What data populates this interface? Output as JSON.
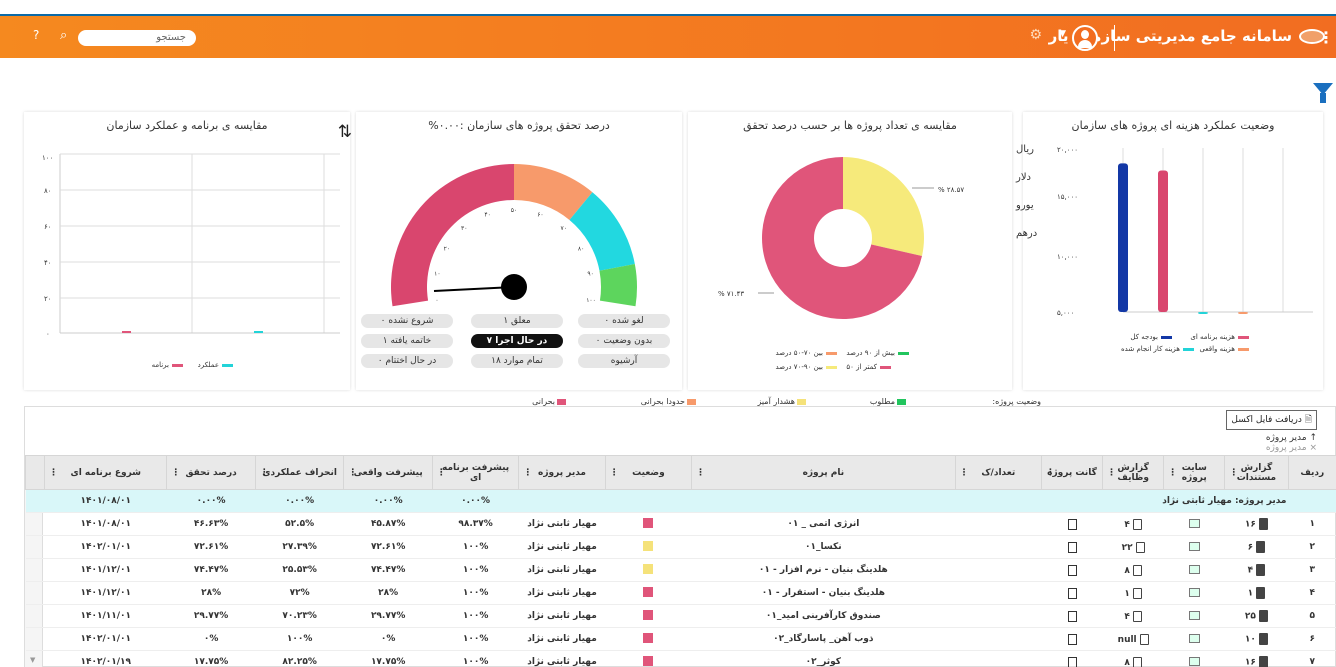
{
  "header": {
    "title": "سامانه جامع مدیریتی سازمان یار",
    "search_placeholder": "جستجو",
    "help_label": "?"
  },
  "cost_chart": {
    "title": "وضعیت عملکرد هزینه ای پروژه های سازمان",
    "currencies": [
      "ریال",
      "دلار",
      "یورو",
      "درهم"
    ],
    "legend": [
      "هزینه برنامه ای",
      "بودجه کل",
      "هزینه واقعی",
      "هزینه کار انجام شده"
    ],
    "yticks": [
      "۲۰,۰۰۰",
      "۱۵,۰۰۰",
      "۱۰,۰۰۰",
      "۵,۰۰۰"
    ]
  },
  "count_chart": {
    "title": "مقایسه ی تعداد پروژه ها بر حسب درصد تحقق",
    "label_big": "% ۷۱.۴۳",
    "label_small": "% ۲۸.۵۷",
    "legend": [
      "بیش از ۹۰ درصد",
      "بین ۷۰-۵۰ درصد",
      "کمتر از ۵۰",
      "بین ۹۰-۷۰ درصد"
    ]
  },
  "progress_chart": {
    "title": "درصد تحقق پروژه های سازمان :۰.۰۰%",
    "gauge_ticks": [
      "۰",
      "۱۰",
      "۲۰",
      "۳۰",
      "۴۰",
      "۵۰",
      "۶۰",
      "۷۰",
      "۸۰",
      "۹۰",
      "۱۰۰"
    ],
    "status_buttons": [
      {
        "label": "لغو شده ۰",
        "active": false
      },
      {
        "label": "معلق ۱",
        "active": false
      },
      {
        "label": "شروع نشده ۰",
        "active": false
      },
      {
        "label": "بدون وضعیت ۰",
        "active": false
      },
      {
        "label": "در حال اجرا ۷",
        "active": true
      },
      {
        "label": "خاتمه یافته ۱",
        "active": false
      },
      {
        "label": "آرشیوه",
        "active": false
      },
      {
        "label": "تمام موارد ۱۸",
        "active": false
      },
      {
        "label": "در حال اختتام ۰",
        "active": false
      }
    ]
  },
  "compare_chart": {
    "title": "مقایسه ی برنامه و عملکرد سازمان",
    "yticks": [
      "۱۰۰",
      "۸۰",
      "۶۰",
      "۴۰",
      "۲۰",
      "۰"
    ],
    "legend": [
      "برنامه",
      "عملکرد"
    ]
  },
  "status_legend": {
    "label": "وضعیت پروژه:",
    "items": [
      {
        "label": "مطلوب",
        "color": "#22c55e"
      },
      {
        "label": "هشدار آمیز",
        "color": "#f5e27a"
      },
      {
        "label": "حدودا بحرانی",
        "color": "#f79a6b"
      },
      {
        "label": "بحرانی",
        "color": "#e0557a"
      }
    ]
  },
  "grid": {
    "excel_label": "دریافت فایل اکسل",
    "group_by": "مدیر پروژه",
    "group_chip_close": "×",
    "columns": [
      "ردیف",
      "گزارش مستندات",
      "سایت پروژه",
      "گزارش وظایف",
      "گانت پروژه",
      "تعداد/ک",
      "نام پروژه",
      "وضعیت",
      "مدیر پروژه",
      "پیشرفت برنامه ای",
      "پیشرفت واقعی",
      "انحراف عملکردی",
      "درصد تحقق",
      "شروع برنامه ای"
    ],
    "group_row": {
      "label": "مدیر پروژه: مهیار ثابتی نژاد",
      "plan": "۰.۰۰%",
      "actual": "۰.۰۰%",
      "deviation": "۰.۰۰%",
      "fulfill": "۰.۰۰%",
      "start": "۱۴۰۱/۰۸/۰۱"
    },
    "rows": [
      {
        "idx": "۱",
        "docs": "۱۶",
        "tasks": "۴",
        "name": "انرژی اتمی _ ۰۱",
        "status": "#e0557a",
        "manager": "مهیار ثابتی نژاد",
        "plan": "۹۸.۳۷%",
        "actual": "۴۵.۸۷%",
        "deviation": "۵۲.۵%",
        "fulfill": "۴۶.۶۳%",
        "start": "۱۴۰۱/۰۸/۰۱"
      },
      {
        "idx": "۲",
        "docs": "۶",
        "tasks": "۲۲",
        "name": "نکسا_۰۱",
        "status": "#f5e27a",
        "manager": "مهیار ثابتی نژاد",
        "plan": "۱۰۰%",
        "actual": "۷۲.۶۱%",
        "deviation": "۲۷.۳۹%",
        "fulfill": "۷۲.۶۱%",
        "start": "۱۴۰۲/۰۱/۰۱"
      },
      {
        "idx": "۳",
        "docs": "۴",
        "tasks": "۸",
        "name": "هلدینگ بنیان - نرم افزار - ۰۱",
        "status": "#f5e27a",
        "manager": "مهیار ثابتی نژاد",
        "plan": "۱۰۰%",
        "actual": "۷۴.۴۷%",
        "deviation": "۲۵.۵۳%",
        "fulfill": "۷۴.۴۷%",
        "start": "۱۴۰۱/۱۲/۰۱"
      },
      {
        "idx": "۴",
        "docs": "۱",
        "tasks": "۱",
        "name": "هلدینگ بنیان - استقرار - ۰۱",
        "status": "#e0557a",
        "manager": "مهیار ثابتی نژاد",
        "plan": "۱۰۰%",
        "actual": "۲۸%",
        "deviation": "۷۲%",
        "fulfill": "۲۸%",
        "start": "۱۴۰۱/۱۲/۰۱"
      },
      {
        "idx": "۵",
        "docs": "۲۵",
        "tasks": "۴",
        "name": "صندوق کارآفرینی امید_۰۱",
        "status": "#e0557a",
        "manager": "مهیار ثابتی نژاد",
        "plan": "۱۰۰%",
        "actual": "۲۹.۷۷%",
        "deviation": "۷۰.۲۳%",
        "fulfill": "۲۹.۷۷%",
        "start": "۱۴۰۱/۱۱/۰۱"
      },
      {
        "idx": "۶",
        "docs": "۱۰",
        "tasks": "null",
        "name": "ذوب آهن_ پاسارگاد_۰۲",
        "status": "#e0557a",
        "manager": "مهیار ثابتی نژاد",
        "plan": "۱۰۰%",
        "actual": "۰%",
        "deviation": "۱۰۰%",
        "fulfill": "۰%",
        "start": "۱۴۰۲/۰۱/۰۱"
      },
      {
        "idx": "۷",
        "docs": "۱۶",
        "tasks": "۸",
        "name": "کوثر_۰۲",
        "status": "#e0557a",
        "manager": "مهیار ثابتی نژاد",
        "plan": "۱۰۰%",
        "actual": "۱۷.۷۵%",
        "deviation": "۸۲.۲۵%",
        "fulfill": "۱۷.۷۵%",
        "start": "۱۴۰۲/۰۱/۱۹"
      }
    ]
  },
  "colors": {
    "header_orange": "#f26d21",
    "bar_navy": "#1338a6",
    "bar_crimson": "#d9466e",
    "bar_cyan": "#22d3d8",
    "bar_orange": "#f79a6b",
    "pie_pink": "#e0557a",
    "pie_yellow": "#f6ea7b",
    "gauge_green": "#5dd55d"
  },
  "chart_data": [
    {
      "type": "bar",
      "title": "وضعیت عملکرد هزینه ای پروژه های سازمان",
      "categories": [
        "بودجه کل",
        "هزینه برنامه ای",
        "هزینه کار انجام شده",
        "هزینه واقعی"
      ],
      "values": [
        18500,
        17800,
        1400,
        200
      ],
      "ylim": [
        4000,
        20000
      ]
    },
    {
      "type": "pie",
      "title": "مقایسه ی تعداد پروژه ها بر حسب درصد تحقق",
      "categories": [
        "بین ۹۰-۷۰ درصد",
        "کمتر از ۵۰"
      ],
      "values": [
        28.57,
        71.43
      ]
    },
    {
      "type": "line",
      "title": "مقایسه ی برنامه و عملکرد سازمان",
      "series": [
        {
          "name": "برنامه",
          "values": [
            0
          ]
        },
        {
          "name": "عملکرد",
          "values": [
            0
          ]
        }
      ],
      "ylim": [
        0,
        100
      ]
    }
  ]
}
